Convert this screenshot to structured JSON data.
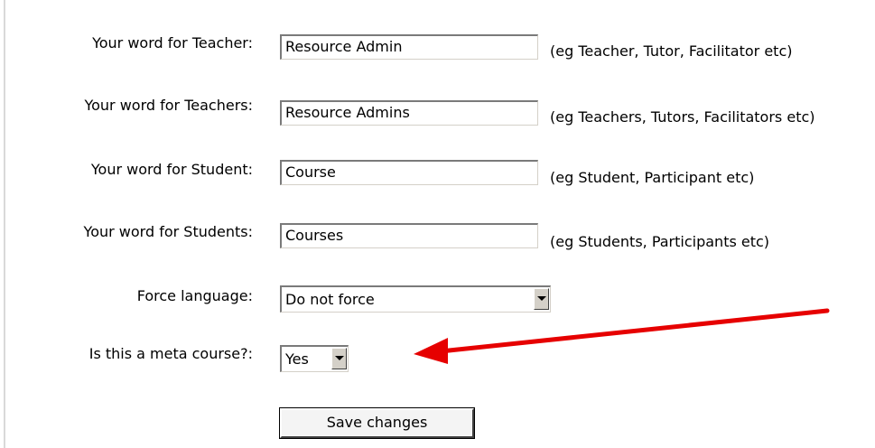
{
  "form": {
    "teacher": {
      "label": "Your word for Teacher:",
      "value": "Resource Admin",
      "hint": "(eg Teacher, Tutor, Facilitator etc)"
    },
    "teachers": {
      "label": "Your word for Teachers:",
      "value": "Resource Admins",
      "hint": "(eg Teachers, Tutors, Facilitators etc)"
    },
    "student": {
      "label": "Your word for Student:",
      "value": "Course",
      "hint": "(eg Student, Participant etc)"
    },
    "students": {
      "label": "Your word for Students:",
      "value": "Courses",
      "hint": "(eg Students, Participants etc)"
    },
    "force_language": {
      "label": "Force language:",
      "selected": "Do not force"
    },
    "meta_course": {
      "label": "Is this a meta course?:",
      "selected": "Yes"
    },
    "save_label": "Save changes"
  },
  "annotation": {
    "arrow_color": "#e60000",
    "arrow_icon": "red-arrow-icon"
  }
}
